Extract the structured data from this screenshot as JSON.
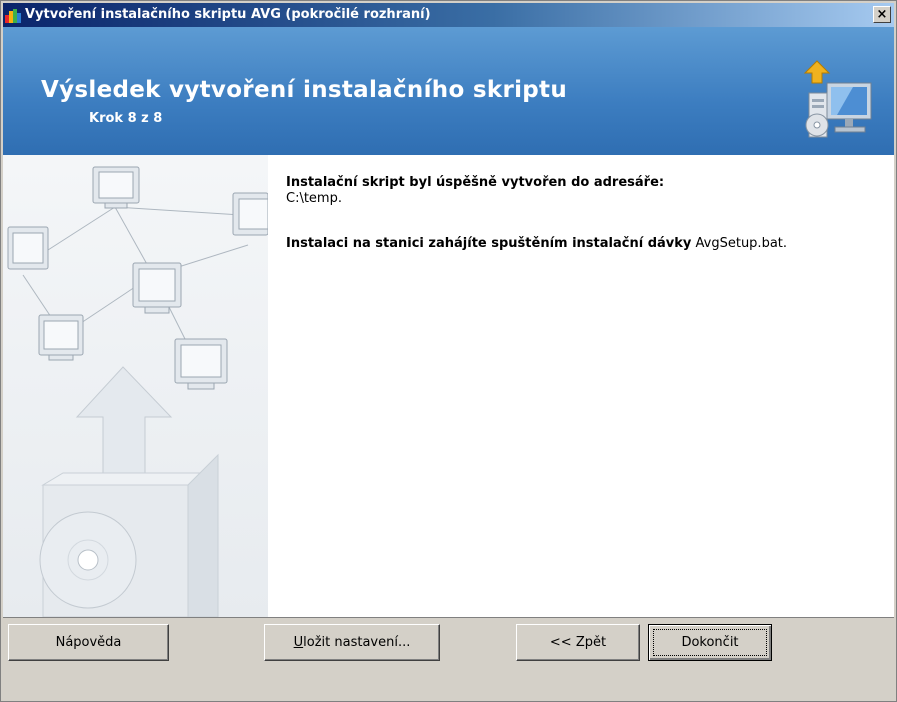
{
  "window": {
    "title": "Vytvoření instalačního skriptu AVG (pokročilé rozhraní)",
    "close_label": "×"
  },
  "header": {
    "title": "Výsledek vytvoření instalačního skriptu",
    "step": "Krok 8 z 8",
    "icon": "install-computer-icon"
  },
  "content": {
    "line1_bold": "Instalační skript byl úspěšně vytvořen do adresáře:",
    "line1_value": "C:\\temp.",
    "line2_bold": "Instalaci na stanici zahájíte spuštěním instalační dávky",
    "line2_value": "AvgSetup.bat."
  },
  "buttons": {
    "help": "Nápověda",
    "save_first": "U",
    "save_rest": "ložit nastavení...",
    "back": "<< Zpět",
    "finish": "Dokončit"
  }
}
